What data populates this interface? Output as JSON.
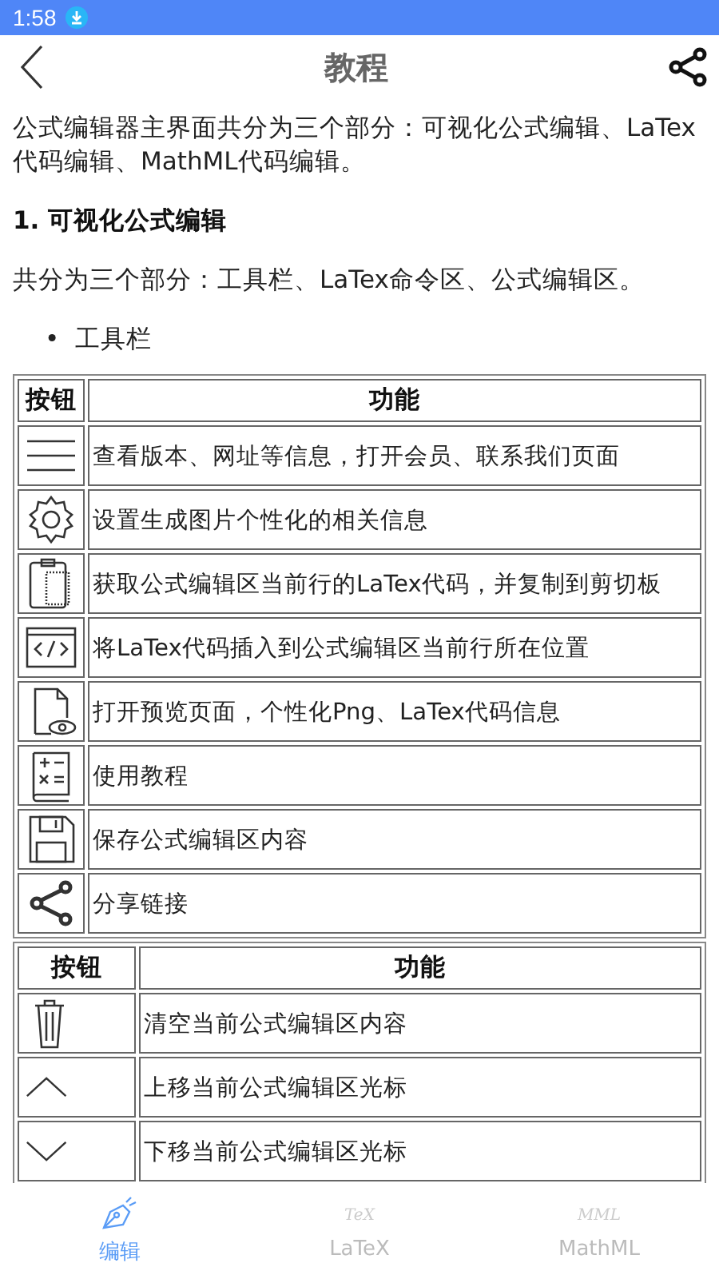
{
  "status_bar": {
    "time": "1:58"
  },
  "header": {
    "title": "教程"
  },
  "intro": "公式编辑器主界面共分为三个部分：可视化公式编辑、LaTex代码编辑、MathML代码编辑。",
  "section_heading": "1. 可视化公式编辑",
  "section_text": "共分为三个部分：工具栏、LaTex命令区、公式编辑区。",
  "bullets": [
    {
      "marker": "•",
      "text": "工具栏"
    }
  ],
  "tables": [
    {
      "columns": [
        "按钮",
        "功能"
      ],
      "rows": [
        {
          "kind": "menu",
          "text": "查看版本、网址等信息，打开会员、联系我们页面"
        },
        {
          "kind": "gear",
          "text": "设置生成图片个性化的相关信息"
        },
        {
          "kind": "clipboard",
          "text": "获取公式编辑区当前行的LaTex代码，并复制到剪切板"
        },
        {
          "kind": "code",
          "text": "将LaTex代码插入到公式编辑区当前行所在位置"
        },
        {
          "kind": "preview",
          "text": "打开预览页面，个性化Png、LaTex代码信息"
        },
        {
          "kind": "tutorial",
          "text": "使用教程"
        },
        {
          "kind": "save",
          "text": "保存公式编辑区内容"
        },
        {
          "kind": "share",
          "text": "分享链接"
        }
      ]
    },
    {
      "columns": [
        "按钮",
        "功能"
      ],
      "rows": [
        {
          "kind": "trash",
          "text": "清空当前公式编辑区内容"
        },
        {
          "kind": "up",
          "text": "上移当前公式编辑区光标"
        },
        {
          "kind": "down",
          "text": "下移当前公式编辑区光标"
        }
      ]
    }
  ],
  "bottom_nav": [
    {
      "kind": "pen",
      "label": "编辑",
      "selected": true
    },
    {
      "kind": "mark",
      "icon_text": "TeX",
      "label": "LaTeX",
      "selected": false
    },
    {
      "kind": "mark",
      "icon_text": "MML",
      "label": "MathML",
      "selected": false
    }
  ]
}
